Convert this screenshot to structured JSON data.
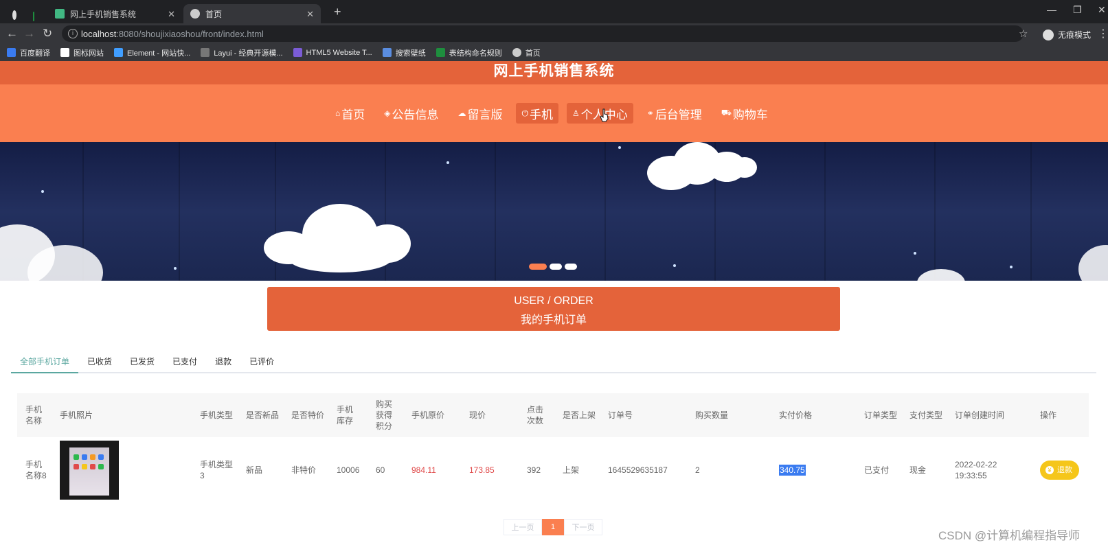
{
  "browser": {
    "tabs": [
      {
        "title": "网上手机销售系统",
        "active": false
      },
      {
        "title": "首页",
        "active": true
      }
    ],
    "url_host": "localhost",
    "url_rest": ":8080/shoujixiaoshou/front/index.html",
    "incognito_label": "无痕模式",
    "bookmarks": [
      "百度翻译",
      "图标网站",
      "Element - 网站快...",
      "Layui - 经典开源模...",
      "HTML5 Website T...",
      "搜索壁纸",
      "表结构命名规则",
      "首页"
    ]
  },
  "site": {
    "title": "网上手机销售系统",
    "nav": [
      {
        "label": "首页",
        "icon": "home-icon",
        "glyph": "⌂"
      },
      {
        "label": "公告信息",
        "icon": "layers-icon",
        "glyph": "◈"
      },
      {
        "label": "留言版",
        "icon": "cloud-icon",
        "glyph": "☁"
      },
      {
        "label": "手机",
        "icon": "power-icon",
        "glyph": "⏻"
      },
      {
        "label": "个人中心",
        "icon": "user-icon",
        "glyph": "♙"
      },
      {
        "label": "后台管理",
        "icon": "link-icon",
        "glyph": "⚭"
      },
      {
        "label": "购物车",
        "icon": "cart-icon",
        "glyph": "⛟"
      }
    ],
    "highlighted_nav": [
      "手机",
      "个人中心"
    ]
  },
  "banner": {
    "slides": 3,
    "active_slide": 1
  },
  "order_header": {
    "en": "USER / ORDER",
    "cn": "我的手机订单"
  },
  "order_tabs": [
    "全部手机订单",
    "已收货",
    "已发货",
    "已支付",
    "退款",
    "已评价"
  ],
  "table": {
    "headers": [
      "手机名称",
      "手机照片",
      "手机类型",
      "是否新品",
      "是否特价",
      "手机库存",
      "购买获得积分",
      "手机原价",
      "现价",
      "点击次数",
      "是否上架",
      "订单号",
      "购买数量",
      "实付价格",
      "订单类型",
      "支付类型",
      "订单创建时间",
      "操作"
    ],
    "rows": [
      {
        "name": "手机名称8",
        "type": "手机类型3",
        "is_new": "新品",
        "is_special": "非特价",
        "stock": "10006",
        "points": "60",
        "original_price": "984.11",
        "current_price": "173.85",
        "clicks": "392",
        "on_shelf": "上架",
        "order_no": "1645529635187",
        "quantity": "2",
        "paid_price": "340.75",
        "order_type": "已支付",
        "pay_type": "现金",
        "created": "2022-02-22 19:33:55",
        "action": "退款"
      }
    ]
  },
  "pager": {
    "prev": "上一页",
    "current": "1",
    "next": "下一页"
  },
  "watermark": "CSDN @计算机编程指导师",
  "colors": {
    "header_dark": "#e4633a",
    "header_light": "#fa7f50",
    "tab_active": "#5ba7a0",
    "price_red": "#e04a4a",
    "refund_yellow": "#f5c61a"
  }
}
